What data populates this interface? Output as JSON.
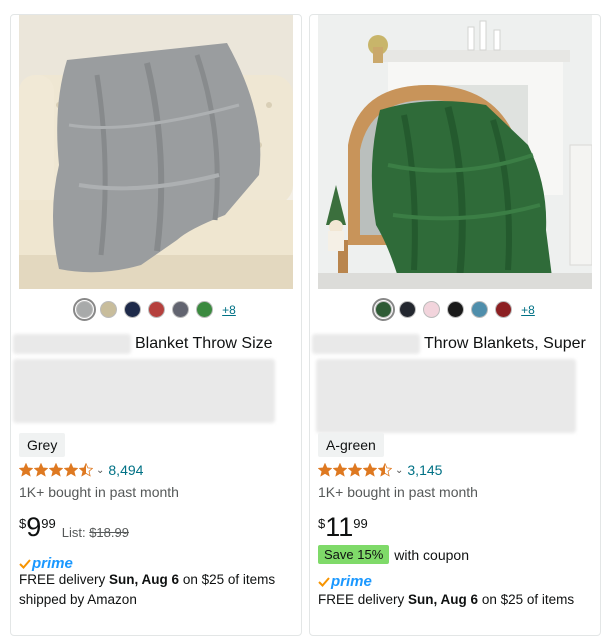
{
  "products": [
    {
      "title_visible": "Blanket Throw Size",
      "swatches": [
        "#a8aaaa",
        "#c8bd9c",
        "#1e2a4a",
        "#b5403d",
        "#626470",
        "#3b8a3f"
      ],
      "selected_swatch": 0,
      "more_colors": "+8",
      "variant": "Grey",
      "rating_stars": 4.5,
      "rating_count": "8,494",
      "bought": "1K+ bought in past month",
      "price_symbol": "$",
      "price_whole": "9",
      "price_fraction": "99",
      "list_label": "List:",
      "list_price": "$18.99",
      "prime_label": "prime",
      "delivery_prefix": "FREE delivery",
      "delivery_date": "Sun, Aug 6",
      "delivery_suffix": "on $25 of items shipped by Amazon"
    },
    {
      "title_visible": "Throw Blankets, Super",
      "swatches": [
        "#2e5b35",
        "#23272f",
        "#f2d4dc",
        "#1a1a1a",
        "#4f8eab",
        "#8c1f22"
      ],
      "selected_swatch": 0,
      "more_colors": "+8",
      "variant": "A-green",
      "rating_stars": 4.5,
      "rating_count": "3,145",
      "bought": "1K+ bought in past month",
      "price_symbol": "$",
      "price_whole": "11",
      "price_fraction": "99",
      "coupon_badge": "Save 15%",
      "coupon_text": "with coupon",
      "prime_label": "prime",
      "delivery_prefix": "FREE delivery",
      "delivery_date": "Sun, Aug 6",
      "delivery_suffix": "on $25 of items"
    }
  ],
  "colors": {
    "star": "#de7921",
    "link": "#007185",
    "prime": "#1a98ff",
    "coupon": "#7fda69"
  }
}
